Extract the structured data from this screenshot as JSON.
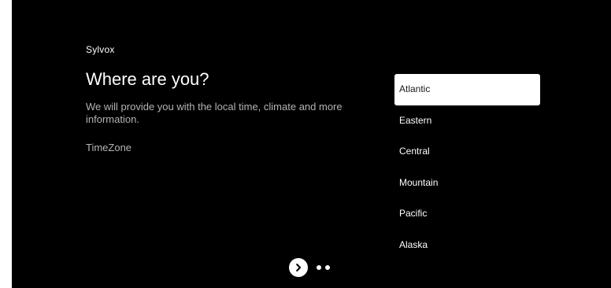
{
  "brand": "Sylvox",
  "page": {
    "title": "Where are you?",
    "subtitle": "We will provide you with the local time, climate and more information.",
    "section_label": "TimeZone"
  },
  "timezones": {
    "selected": "Atlantic",
    "items": [
      {
        "label": "Atlantic"
      },
      {
        "label": "Eastern"
      },
      {
        "label": "Central"
      },
      {
        "label": "Mountain"
      },
      {
        "label": "Pacific"
      },
      {
        "label": "Alaska"
      }
    ]
  },
  "pager": {
    "next_icon": "chevron-right-icon",
    "dot_count": 2
  },
  "colors": {
    "background": "#000000",
    "text_primary": "#ffffff",
    "text_secondary": "#b3b3b3",
    "selection_bg": "#ffffff",
    "selection_text": "#1a1a1a"
  }
}
